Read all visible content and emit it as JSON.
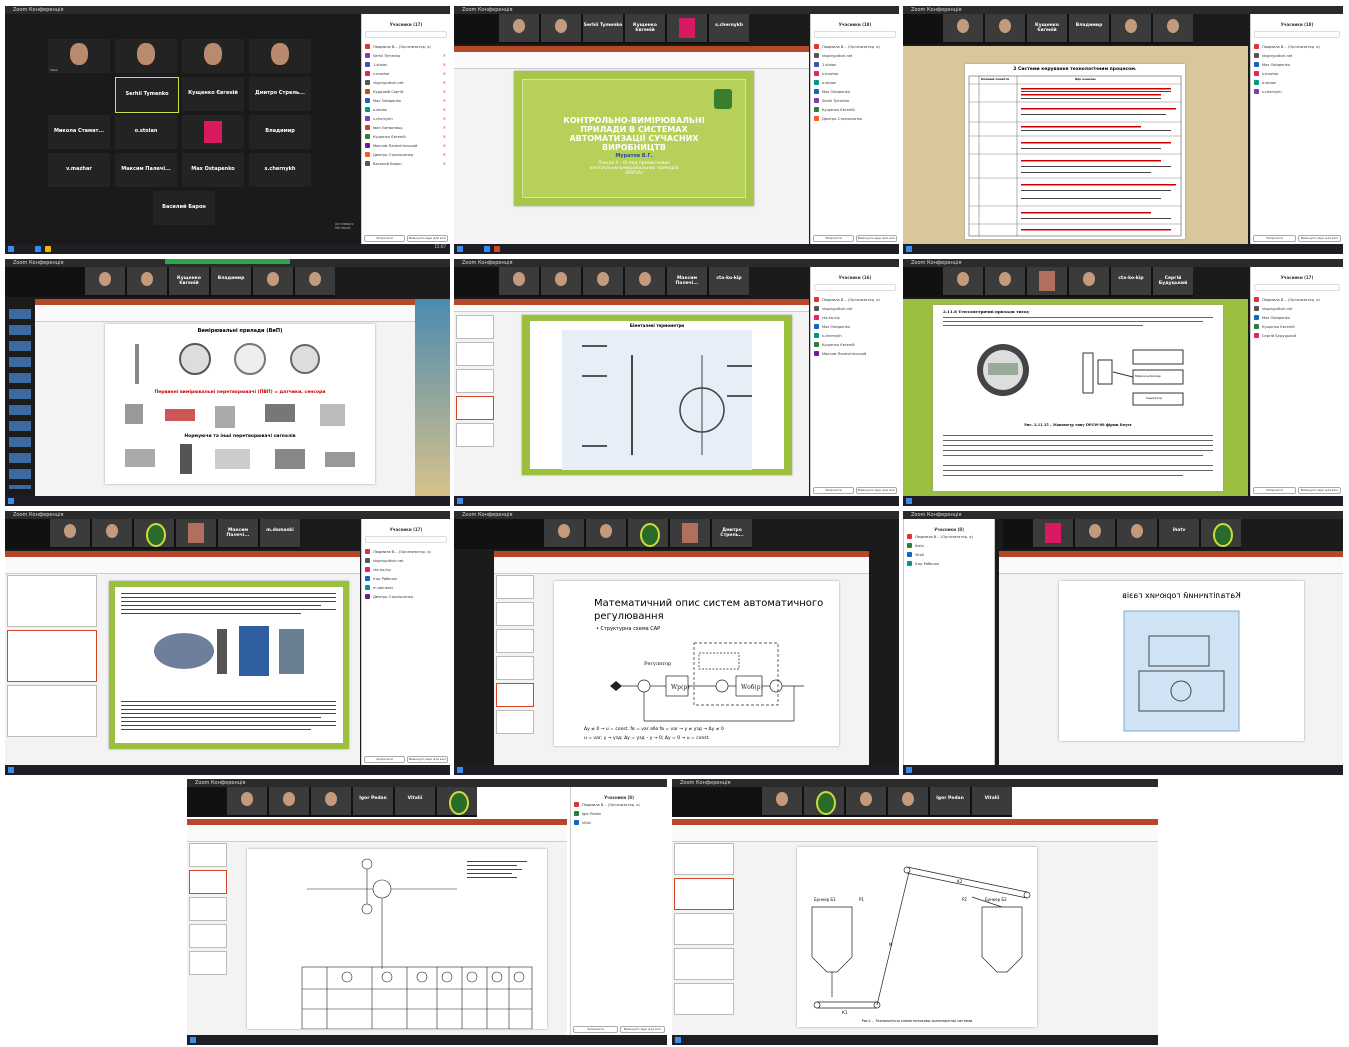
{
  "window_title": "Zoom Конференція",
  "participants_header_17": "Учасники (17)",
  "participants_header_18": "Учасники (18)",
  "participants_header_16": "Учасники (16)",
  "participants_header_8": "Учасники (8)",
  "search_placeholder": "Знайти учасника",
  "invite_label": "Запросити",
  "mute_all_label": "Вимкнути звук для всіх",
  "activate_windows": "Активація Windows",
  "tile_names": [
    "Serhii Tymenko",
    "Кущенко Євгеній",
    "Дмитро Стрель...",
    "Микола Стамат...",
    "o.stoian",
    "Владимир",
    "v.mazhar",
    "Максим Палечі...",
    "Max Ostapenko",
    "s.chernykh",
    "Василий Барон"
  ],
  "participants_list": [
    "Людмила В... (Организатор, я)",
    "Serhii Tymenko",
    "1.stoian",
    "v.mazhar",
    "vkgorypdkuh.net",
    "Кудрявій Сергій",
    "Max Ostapenko",
    "o.stoian",
    "s.chernykh",
    "Іван Литвинець",
    "Кущенко Євгеній",
    "Максим Палечігінський",
    "Дмитро Стрельченко",
    "Василий Барон",
    "Микола Стаматов",
    "Ігор Рибачок",
    "Vitali"
  ],
  "slide1": {
    "title": "КОНТРОЛЬНО-ВИМІРЮВАЛЬНІ ПРИЛАДИ В СИСТЕМАХ АВТОМАТИЗАЦІЇ СУЧАСНИХ ВИРОБНИЦТВ",
    "author": "Муратов В.Г.",
    "subtitle": "Лекція 3 - Огляд промислових контрольно-вимірювальних приладів (КВПіА)"
  },
  "slide2": {
    "title": "2 Системи керування технологічним процесом.",
    "col1": "Основні поняття",
    "col2": "Що означає"
  },
  "slide3": {
    "title": "Вимірювальні прилади (ВиП)",
    "subtitle": "Первинні вимірювальні перетворювачі (ПВП) = датчики, сенсори",
    "bottom": "Нормуючи та інші перетворювачі сигналів"
  },
  "slide4": {
    "title": "Біметалеві термометри"
  },
  "slide5": {
    "heading": "2.11.8 Тензометричні прилади тиску",
    "caption": "Рис. 2.11.15 – Манометр типу DPGW-08 фірми Dwyer",
    "box1": "Мікроконтролер",
    "box2": "Індикатор"
  },
  "slide7": {
    "title": "Математичний опис систем автоматичного регулювання",
    "bullet": "• Структурна схема САР",
    "block": "Регулятор",
    "eq1": "Δy ≠ 0 → u = const. fв = var або fв = var → y ≠ yзд → Δy ≠ 0",
    "eq2": "u = var; y → yзд; Δy = yзд – y → 0; Δy = 0 → u = const."
  },
  "slide8": {
    "title": "Каталітичний горючих газів"
  },
  "slide10": {
    "label1": "Бункер Б1",
    "label2": "Бункер Б2",
    "label3": "Р1",
    "label4": "Р2",
    "label5": "К1",
    "label6": "К2",
    "label7": "М",
    "caption": "Рис1. – Технологічна схема потоково-транспортної системи"
  },
  "names_small": [
    "Igor Pedan",
    "Vitalii",
    "cta-ko-kip",
    "Сергій Будуцький",
    "Максим Палечі...",
    "m.damaski",
    "Дмитро Стрель...",
    "ihatv"
  ],
  "clock_time": "15:07",
  "clock_date": "12.05.2021",
  "colors": {
    "ppt_red": "#b7472a",
    "green_frame": "#9bbf3f",
    "zoom_blue": "#2d8cff",
    "word_blue": "#2b579a"
  }
}
